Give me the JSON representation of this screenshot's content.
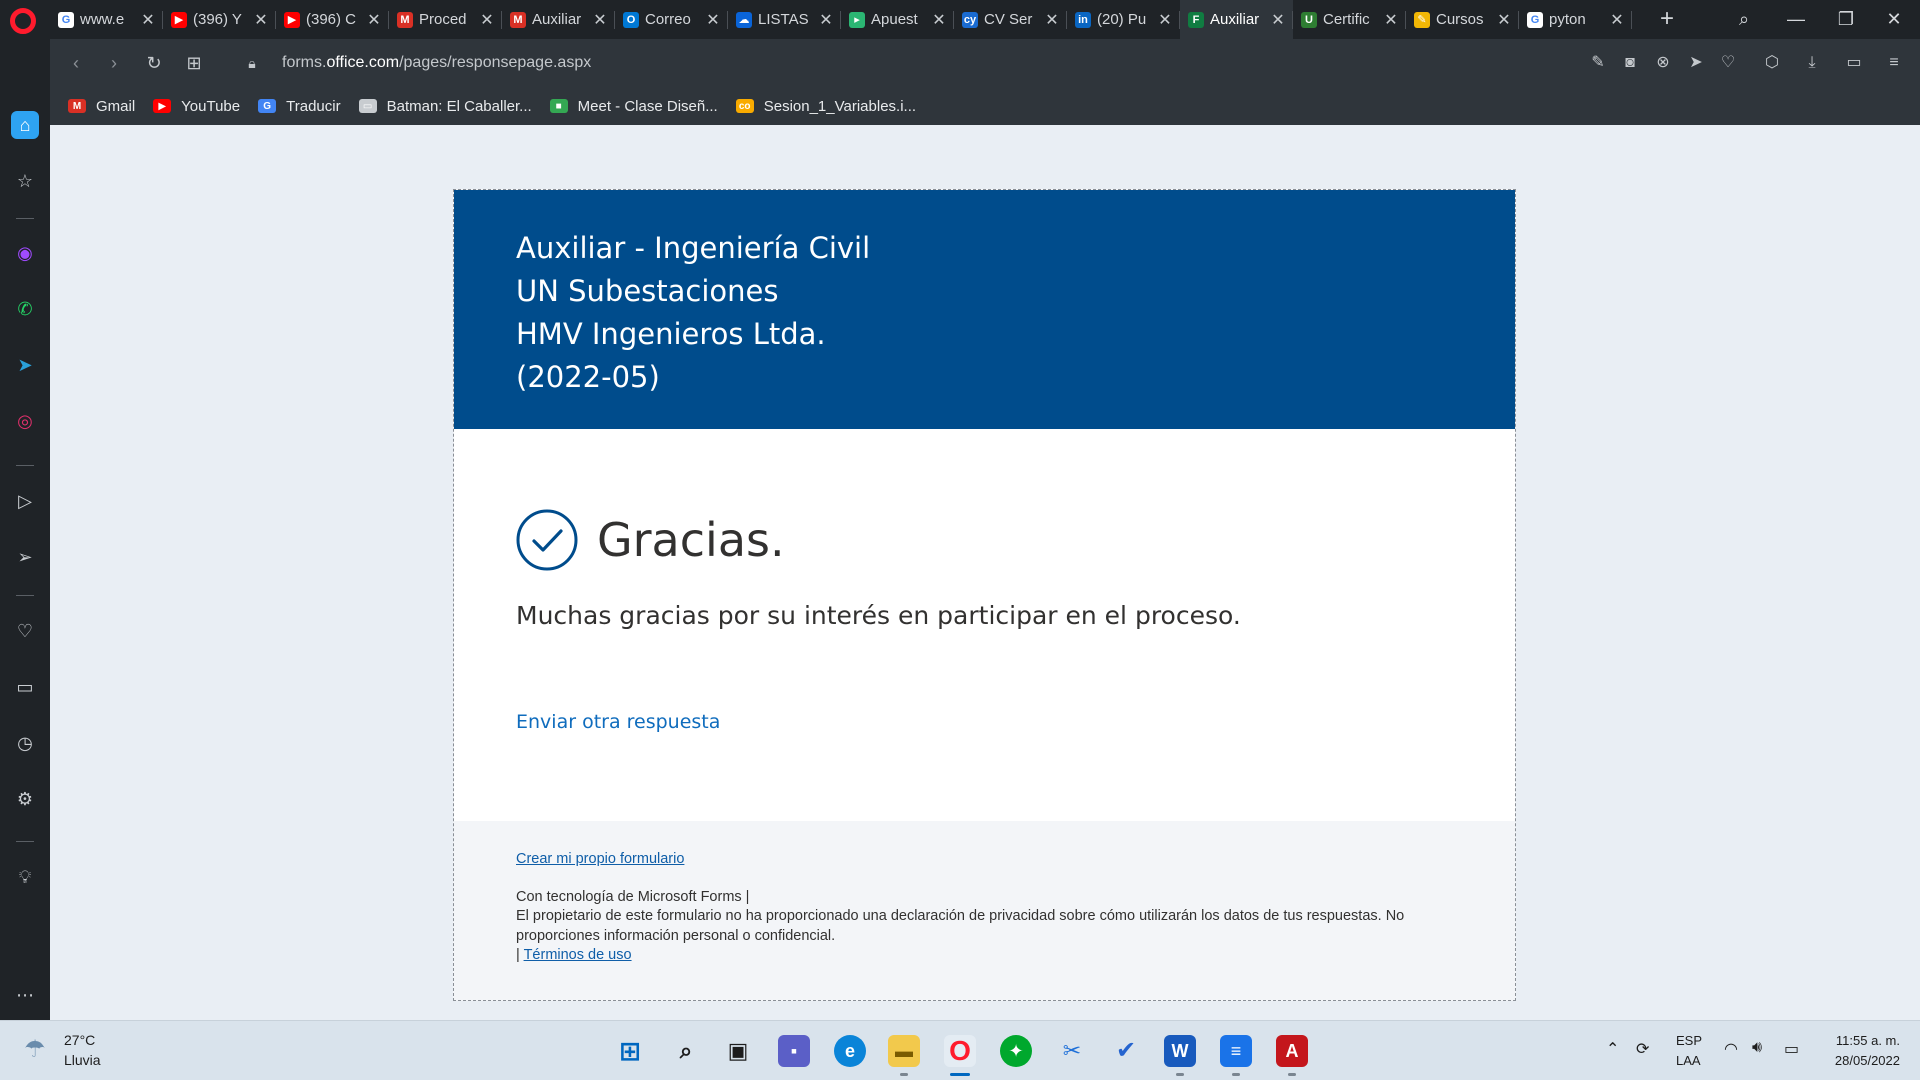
{
  "browser": {
    "tabs": [
      {
        "title": "www.e",
        "color": "#ffffff",
        "glyph": "G"
      },
      {
        "title": "(396) Y",
        "color": "#ff0000",
        "glyph": "▶"
      },
      {
        "title": "(396) C",
        "color": "#ff0000",
        "glyph": "▶"
      },
      {
        "title": "Proced",
        "color": "#d93025",
        "glyph": "M"
      },
      {
        "title": "Auxiliar",
        "color": "#d93025",
        "glyph": "M"
      },
      {
        "title": "Correo",
        "color": "#0078d4",
        "glyph": "O"
      },
      {
        "title": "LISTAS",
        "color": "#0a64d8",
        "glyph": "☁"
      },
      {
        "title": "Apuest",
        "color": "#2bb673",
        "glyph": "▸"
      },
      {
        "title": "CV Ser",
        "color": "#1a6bd1",
        "glyph": "cy"
      },
      {
        "title": "(20) Pu",
        "color": "#0a66c2",
        "glyph": "in"
      },
      {
        "title": "Auxiliar",
        "color": "#107c41",
        "glyph": "F"
      },
      {
        "title": "Certific",
        "color": "#2e7d32",
        "glyph": "U"
      },
      {
        "title": "Cursos",
        "color": "#f2b705",
        "glyph": "✎"
      },
      {
        "title": "pyton",
        "color": "#ffffff",
        "glyph": "G"
      }
    ],
    "active_tab_index": 10,
    "url_prefix": "forms.",
    "url_host": "office.com",
    "url_path": "/pages/responsepage.aspx",
    "bookmarks": [
      {
        "label": "Gmail",
        "color": "#d93025",
        "glyph": "M"
      },
      {
        "label": "YouTube",
        "color": "#ff0000",
        "glyph": "▶"
      },
      {
        "label": "Traducir",
        "color": "#4285f4",
        "glyph": "G"
      },
      {
        "label": "Batman: El Caballer...",
        "color": "#c8ccd0",
        "glyph": "▭"
      },
      {
        "label": "Meet - Clase Diseñ...",
        "color": "#34a853",
        "glyph": "■"
      },
      {
        "label": "Sesion_1_Variables.i...",
        "color": "#f9ab00",
        "glyph": "co"
      }
    ]
  },
  "form": {
    "header_lines": [
      "Auxiliar - Ingeniería Civil",
      "UN Subestaciones",
      "HMV Ingenieros Ltda.",
      "(2022-05)"
    ],
    "thanks_title": "Gracias.",
    "message": "Muchas gracias por su interés en participar en el proceso.",
    "another_response": "Enviar otra respuesta",
    "footer": {
      "create_own": "Crear mi propio formulario",
      "powered_by": "Con tecnología de Microsoft Forms |",
      "privacy": "El propietario de este formulario no ha proporcionado una declaración de privacidad sobre cómo utilizarán los datos de tus respuestas. No proporciones información personal o confidencial.",
      "separator": "|",
      "terms": "Términos de uso"
    },
    "colors": {
      "header": "#004c8c",
      "link": "#0f6cbd"
    }
  },
  "taskbar": {
    "weather_temp": "27°C",
    "weather_desc": "Lluvia",
    "language": "ESP",
    "keyboard": "LAA",
    "time": "11:55 a. m.",
    "date": "28/05/2022"
  }
}
